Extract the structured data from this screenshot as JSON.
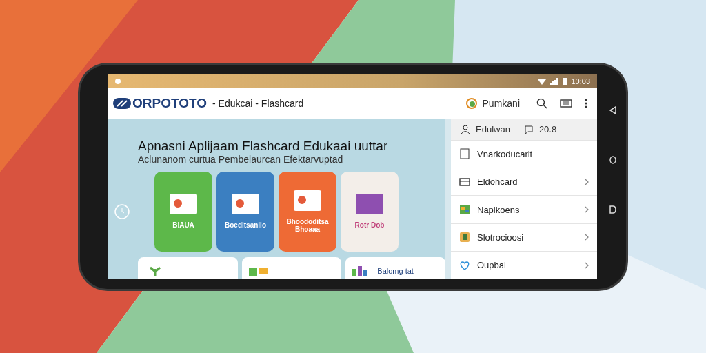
{
  "status_bar": {
    "time": "10:03"
  },
  "app_bar": {
    "logo": "ORPOTOTO",
    "title": "- Edukcai - Flashcard",
    "user": "Pumkani"
  },
  "hero": {
    "title": "Apnasni Aplijaam Flashcard Edukaai uuttar",
    "subtitle": "Aclunanom curtua Pembelaurcan Efektarvuptad"
  },
  "cards": [
    {
      "kind": "green",
      "label": "BIAUA"
    },
    {
      "kind": "blue",
      "label": "Boeditsaniio"
    },
    {
      "kind": "orange",
      "label": "Bhoododitsa Bhoaaa"
    },
    {
      "kind": "light",
      "label": "Rotr Dob"
    }
  ],
  "lower_cards": [
    {
      "kind": "plant"
    },
    {
      "kind": "tiles"
    },
    {
      "kind": "bars",
      "label": "Balomg tat"
    }
  ],
  "side_panel": {
    "header": {
      "label": "Edulwan",
      "count": "20.8"
    },
    "items": [
      {
        "kind": "doc",
        "label": "Vnarkoducarlt",
        "chevron": false
      },
      {
        "kind": "card",
        "label": "Eldohcard",
        "chevron": true
      },
      {
        "kind": "map",
        "label": "Naplkoens",
        "chevron": true
      },
      {
        "kind": "book",
        "label": "Slotrocioosi",
        "chevron": true
      },
      {
        "kind": "heart",
        "label": "Oupbal",
        "chevron": true
      }
    ]
  }
}
